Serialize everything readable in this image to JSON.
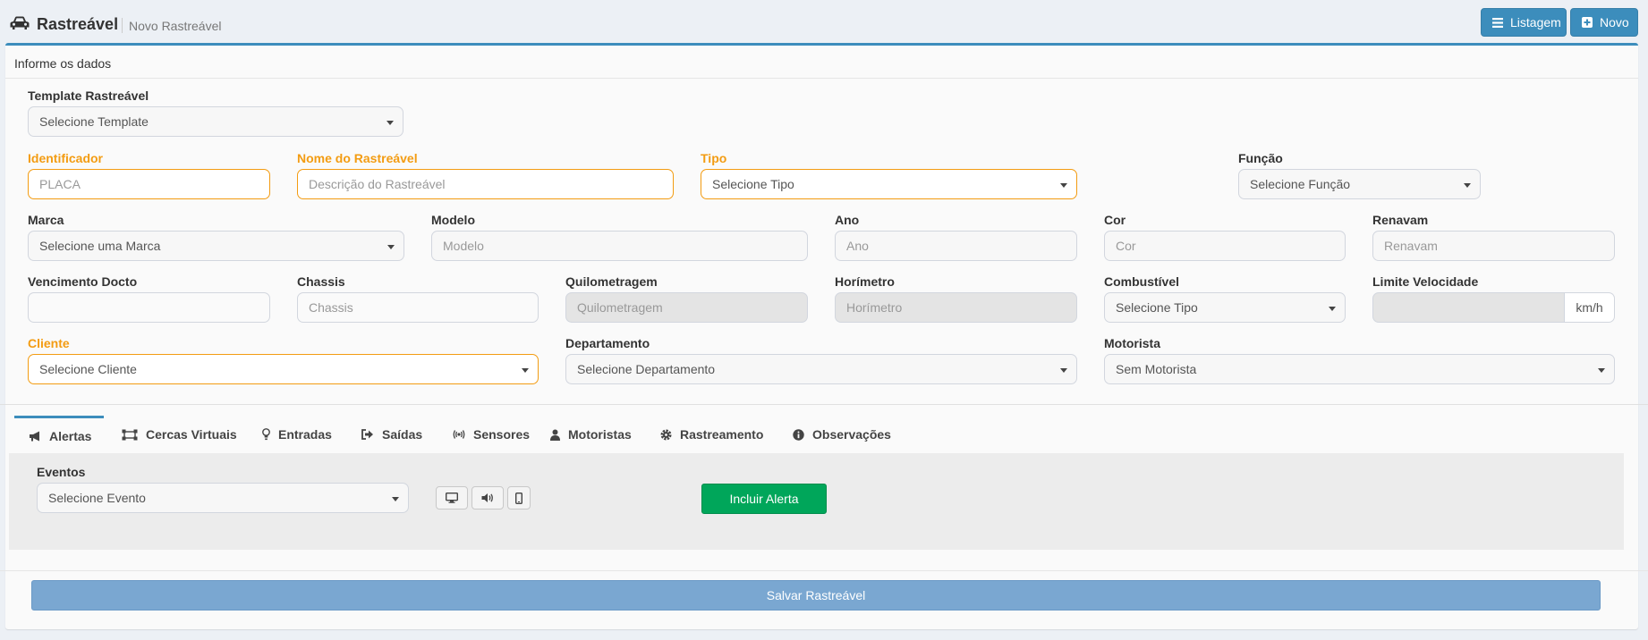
{
  "header": {
    "title": "Rastreável",
    "subtitle": "Novo Rastreável",
    "list_button": "Listagem",
    "new_button": "Novo"
  },
  "box": {
    "title": "Informe os dados"
  },
  "form": {
    "template": {
      "label": "Template Rastreável",
      "value": "Selecione Template"
    },
    "identificador": {
      "label": "Identificador",
      "placeholder": "PLACA"
    },
    "nome": {
      "label": "Nome do Rastreável",
      "placeholder": "Descrição do Rastreável"
    },
    "tipo": {
      "label": "Tipo",
      "value": "Selecione Tipo"
    },
    "funcao": {
      "label": "Função",
      "value": "Selecione Função"
    },
    "marca": {
      "label": "Marca",
      "value": "Selecione uma Marca"
    },
    "modelo": {
      "label": "Modelo",
      "placeholder": "Modelo"
    },
    "ano": {
      "label": "Ano",
      "placeholder": "Ano"
    },
    "cor": {
      "label": "Cor",
      "placeholder": "Cor"
    },
    "renavam": {
      "label": "Renavam",
      "placeholder": "Renavam"
    },
    "vencimento": {
      "label": "Vencimento Docto",
      "value": ""
    },
    "chassis": {
      "label": "Chassis",
      "placeholder": "Chassis"
    },
    "quilometragem": {
      "label": "Quilometragem",
      "placeholder": "Quilometragem"
    },
    "horimetro": {
      "label": "Horímetro",
      "placeholder": "Horímetro"
    },
    "combustivel": {
      "label": "Combustível",
      "value": "Selecione Tipo"
    },
    "limite": {
      "label": "Limite Velocidade",
      "unit": "km/h"
    },
    "cliente": {
      "label": "Cliente",
      "value": "Selecione Cliente"
    },
    "departamento": {
      "label": "Departamento",
      "value": "Selecione Departamento"
    },
    "motorista": {
      "label": "Motorista",
      "value": "Sem Motorista"
    }
  },
  "tabs": [
    {
      "label": "Alertas",
      "icon": "bullhorn-icon"
    },
    {
      "label": "Cercas Virtuais",
      "icon": "fence-icon"
    },
    {
      "label": "Entradas",
      "icon": "lightbulb-icon"
    },
    {
      "label": "Saídas",
      "icon": "sign-out-icon"
    },
    {
      "label": "Sensores",
      "icon": "broadcast-icon"
    },
    {
      "label": "Motoristas",
      "icon": "user-icon"
    },
    {
      "label": "Rastreamento",
      "icon": "gear-icon"
    },
    {
      "label": "Observações",
      "icon": "info-icon"
    }
  ],
  "alert_tab": {
    "events_label": "Eventos",
    "events_value": "Selecione Evento",
    "include_button": "Incluir Alerta"
  },
  "save_button": "Salvar Rastreável",
  "colors": {
    "primary": "#3c8dbc",
    "required": "#f39c12",
    "success": "#00a65a",
    "save": "#7aa7d1"
  }
}
